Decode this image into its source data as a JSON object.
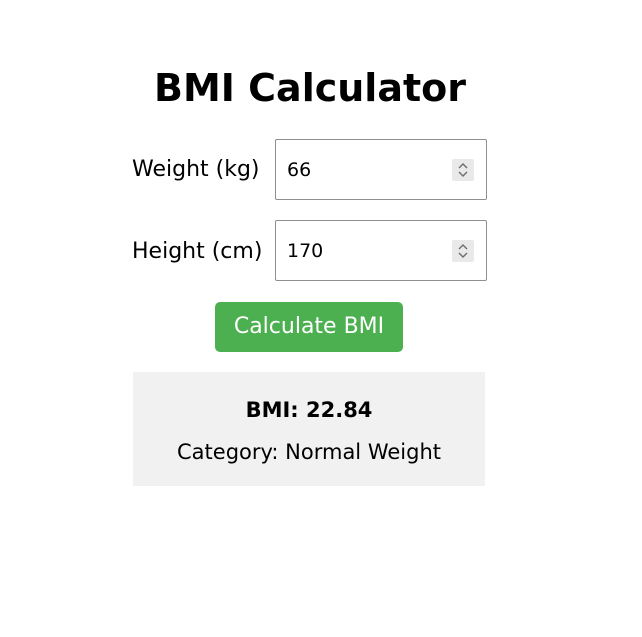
{
  "page": {
    "title": "BMI Calculator"
  },
  "form": {
    "weight": {
      "label": "Weight (kg)",
      "value": "66"
    },
    "height": {
      "label": "Height (cm)",
      "value": "170"
    },
    "calculate_label": "Calculate BMI"
  },
  "result": {
    "bmi_text": "BMI: 22.84",
    "category_text": "Category: Normal Weight"
  },
  "icons": {
    "spinner": "spinner-updown-icon"
  },
  "colors": {
    "accent": "#4caf50",
    "result_background": "#f1f1f1",
    "button_text": "#ffffff"
  }
}
